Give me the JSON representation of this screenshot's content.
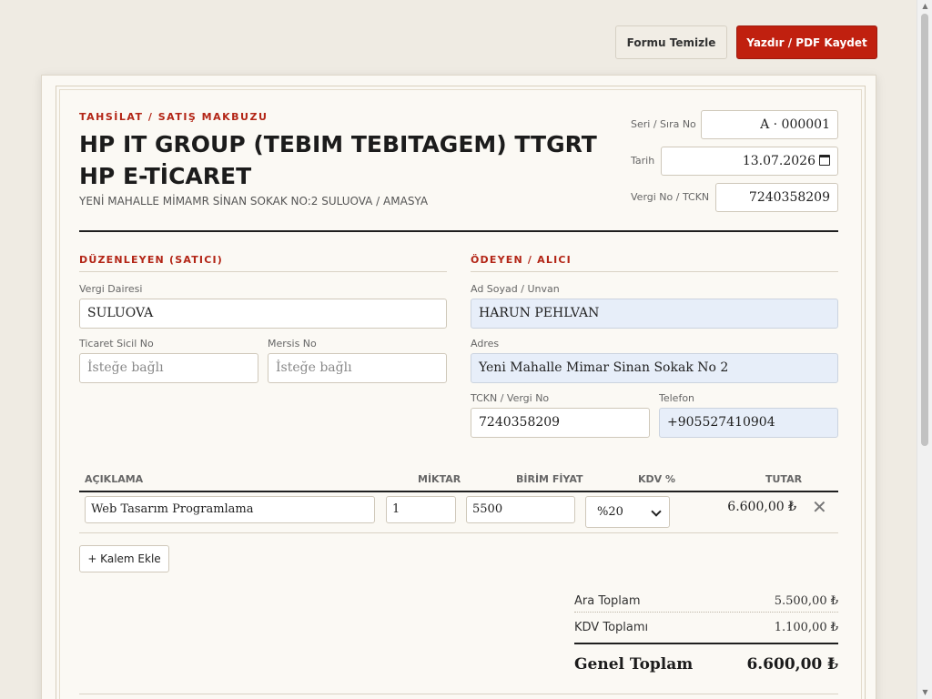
{
  "toolbar": {
    "clear_label": "Formu Temizle",
    "print_label": "Yazdır / PDF Kaydet"
  },
  "header": {
    "doc_type": "TAHSİLAT / SATIŞ MAKBUZU",
    "company": "HP IT GROUP (TEBIM TEBITAGEM) TTGRT HP E-TİCARET",
    "address": "YENİ MAHALLE MİMAMR SİNAN SOKAK NO:2 SULUOVA / AMASYA"
  },
  "meta": {
    "serial_label": "Seri / Sıra No",
    "serial_value": "A · 000001",
    "date_label": "Tarih",
    "date_value": "13.07.2026",
    "tax_label": "Vergi No / TCKN",
    "tax_value": "7240358209"
  },
  "seller": {
    "title": "DÜZENLEYEN (SATICI)",
    "tax_office_label": "Vergi Dairesi",
    "tax_office_value": "SULUOVA",
    "trade_reg_label": "Ticaret Sicil No",
    "trade_reg_placeholder": "İsteğe bağlı",
    "mersis_label": "Mersis No",
    "mersis_placeholder": "İsteğe bağlı"
  },
  "buyer": {
    "title": "ÖDEYEN / ALICI",
    "name_label": "Ad Soyad / Unvan",
    "name_value": "HARUN PEHLVAN",
    "address_label": "Adres",
    "address_value": "Yeni Mahalle Mimar Sinan Sokak No 2",
    "tckn_label": "TCKN / Vergi No",
    "tckn_value": "7240358209",
    "phone_label": "Telefon",
    "phone_value": "+905527410904"
  },
  "table": {
    "headers": {
      "description": "AÇIKLAMA",
      "quantity": "MİKTAR",
      "unit_price": "BİRİM FİYAT",
      "vat": "KDV %",
      "total": "TUTAR"
    },
    "rows": [
      {
        "description": "Web Tasarım Programlama",
        "quantity": "1",
        "unit_price": "5500",
        "vat": "%20",
        "total": "6.600,00 ₺"
      }
    ],
    "add_label": "+ Kalem Ekle"
  },
  "summary": {
    "subtotal_label": "Ara Toplam",
    "subtotal_value": "5.500,00 ₺",
    "vat_label": "KDV Toplamı",
    "vat_value": "1.100,00 ₺",
    "grand_label": "Genel Toplam",
    "grand_value": "6.600,00 ₺"
  },
  "colors": {
    "accent": "#c0200f",
    "section_title": "#b32516",
    "filled_field": "#e7eef9",
    "page_bg": "#efebe3",
    "paper_bg": "#fbf9f4"
  }
}
